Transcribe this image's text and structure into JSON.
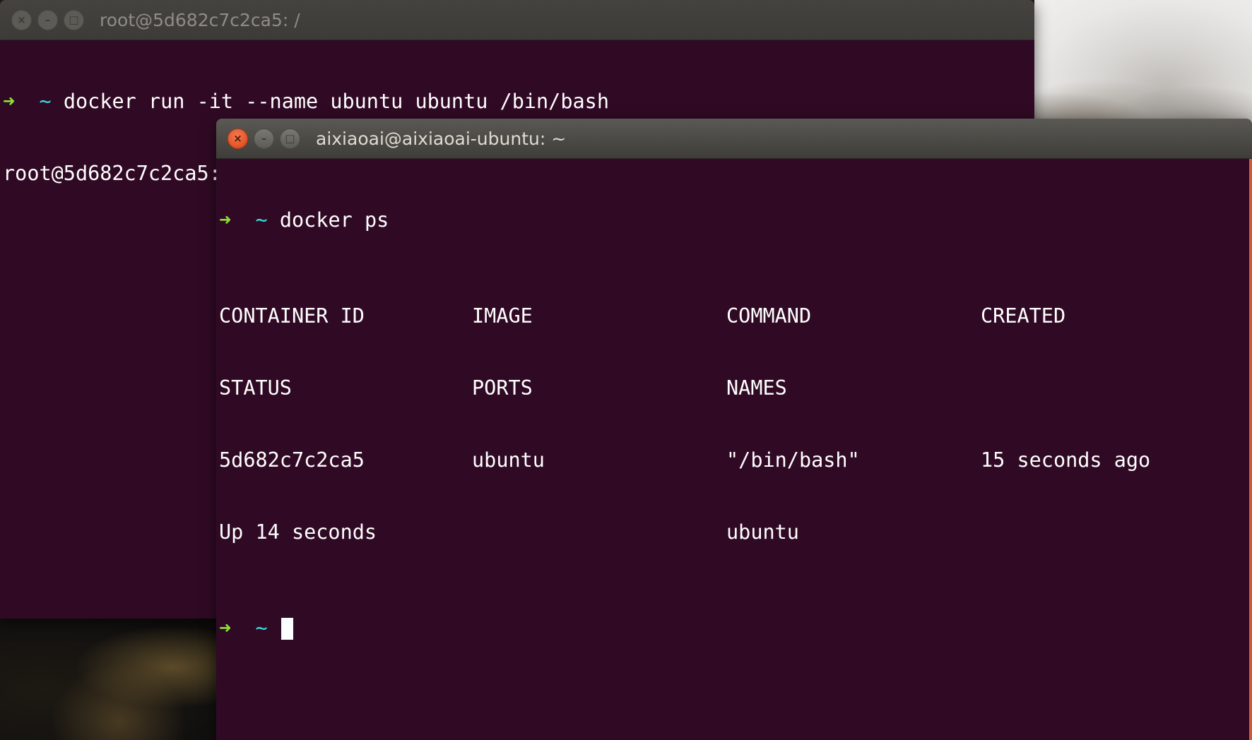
{
  "back_terminal": {
    "title": "root@5d682c7c2ca5: /",
    "prompt_arrow": "➜",
    "prompt_dir": "~",
    "command": "docker run -it --name ubuntu ubuntu /bin/bash",
    "container_prompt": "root@5d682c7c2ca5:/# "
  },
  "front_terminal": {
    "title": "aixiaoai@aixiaoai-ubuntu: ~",
    "prompt_arrow": "➜",
    "prompt_dir": "~",
    "command": "docker ps",
    "table": {
      "header_line1": [
        "CONTAINER ID",
        "IMAGE",
        "COMMAND",
        "CREATED"
      ],
      "header_line2": [
        "STATUS",
        "PORTS",
        "NAMES"
      ],
      "row_line1": [
        "5d682c7c2ca5",
        "ubuntu",
        "\"/bin/bash\"",
        "15 seconds ago"
      ],
      "row_line2": [
        "Up 14 seconds",
        "ubuntu"
      ]
    }
  },
  "window_buttons": {
    "close": "×",
    "minimize": "–",
    "maximize": "□"
  },
  "colors": {
    "terminal_bg": "#300a24",
    "prompt_arrow": "#8ae234",
    "prompt_dir": "#34e2e2",
    "close_button_active": "#e4582a",
    "titlebar": "#3c3b37"
  }
}
